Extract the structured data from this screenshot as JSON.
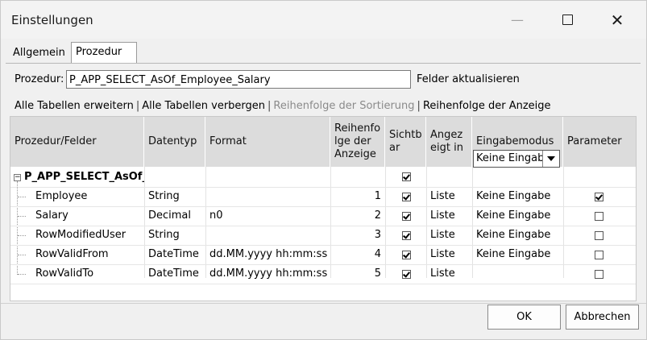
{
  "window": {
    "title": "Einstellungen",
    "minimize_label": "—",
    "close_label": "✕"
  },
  "tabs": [
    {
      "label": "Allgemein",
      "active": false
    },
    {
      "label": "Prozedur",
      "active": true
    }
  ],
  "procedure": {
    "label": "Prozedur:",
    "value": "P_APP_SELECT_AsOf_Employee_Salary",
    "refresh_label": "Felder aktualisieren"
  },
  "links": {
    "expand_all": "Alle Tabellen erweitern",
    "hide_all": "Alle Tabellen verbergen",
    "sort_order": "Reihenfolge der Sortierung",
    "display_order": "Reihenfolge der Anzeige",
    "separator": "|"
  },
  "grid": {
    "headers": {
      "fields": "Prozedur/Felder",
      "datatype": "Datentyp",
      "format": "Format",
      "order": "Reihenfo lge der Anzeige",
      "visible": "Sichtb ar",
      "shown_in": "Angez eigt in",
      "input_mode": "Eingabemodus",
      "parameter": "Parameter"
    },
    "group": {
      "name": "P_APP_SELECT_AsOf_I",
      "expander": "−",
      "visible": true
    },
    "rows": [
      {
        "field": "Employee",
        "datatype": "String",
        "format": "",
        "order": "1",
        "visible": true,
        "shown_in": "Liste",
        "input_mode": "Keine Eingabe",
        "parameter": true
      },
      {
        "field": "Salary",
        "datatype": "Decimal",
        "format": "n0",
        "order": "2",
        "visible": true,
        "shown_in": "Liste",
        "input_mode": "Keine Eingabe",
        "parameter": false
      },
      {
        "field": "RowModifiedUser",
        "datatype": "String",
        "format": "",
        "order": "3",
        "visible": true,
        "shown_in": "Liste",
        "input_mode": "Keine Eingabe",
        "parameter": false
      },
      {
        "field": "RowValidFrom",
        "datatype": "DateTime",
        "format": "dd.MM.yyyy hh:mm:ss",
        "order": "4",
        "visible": true,
        "shown_in": "Liste",
        "input_mode": "Keine Eingabe",
        "parameter": false
      },
      {
        "field": "RowValidTo",
        "datatype": "DateTime",
        "format": "dd.MM.yyyy hh:mm:ss",
        "order": "5",
        "visible": true,
        "shown_in": "Liste",
        "input_mode": "Keine Eingab",
        "parameter": false
      }
    ]
  },
  "buttons": {
    "ok": "OK",
    "cancel": "Abbrechen"
  }
}
